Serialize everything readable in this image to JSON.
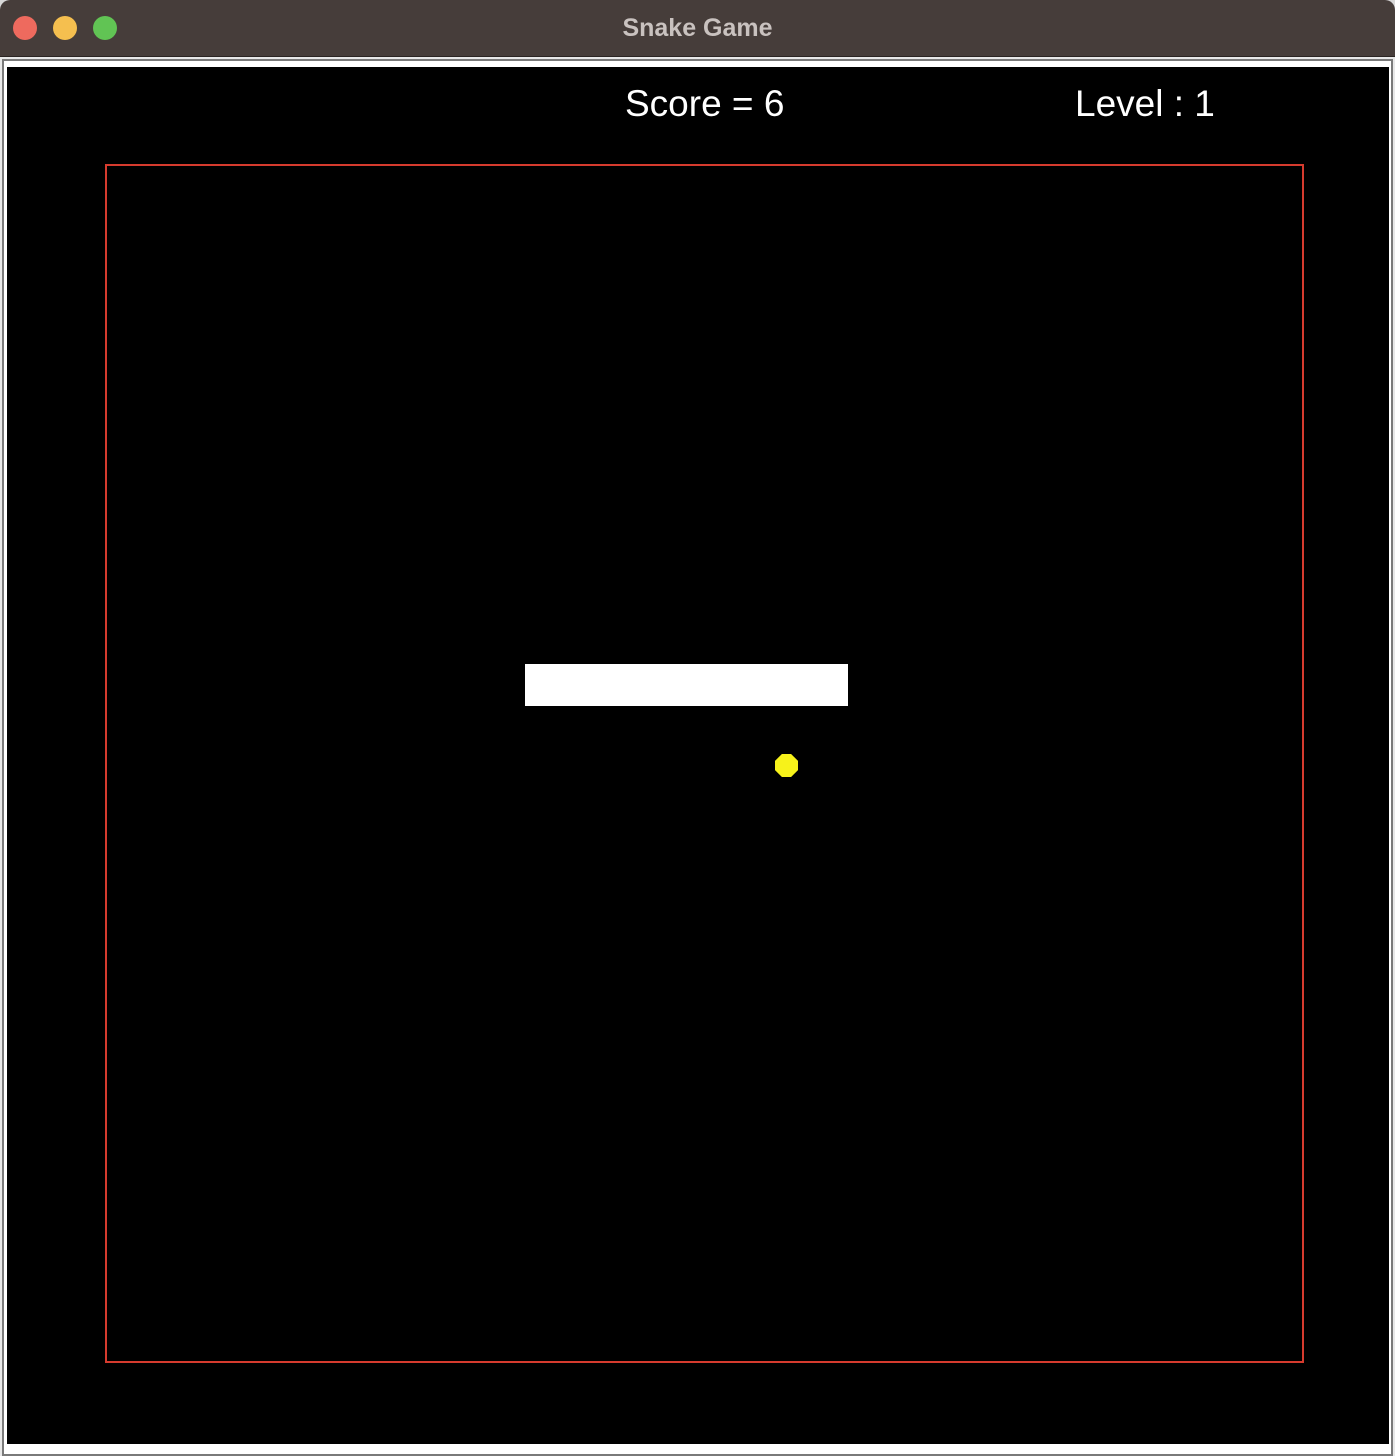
{
  "window": {
    "title": "Snake Game"
  },
  "hud": {
    "score_text": "Score = 6",
    "level_text": "Level : 1"
  },
  "game": {
    "score": 6,
    "level": 1,
    "snake_length": 5,
    "colors": {
      "background": "#000000",
      "arena_border": "#d63b2e",
      "snake": "#ffffff",
      "food": "#f7f21a",
      "text": "#ffffff"
    }
  }
}
